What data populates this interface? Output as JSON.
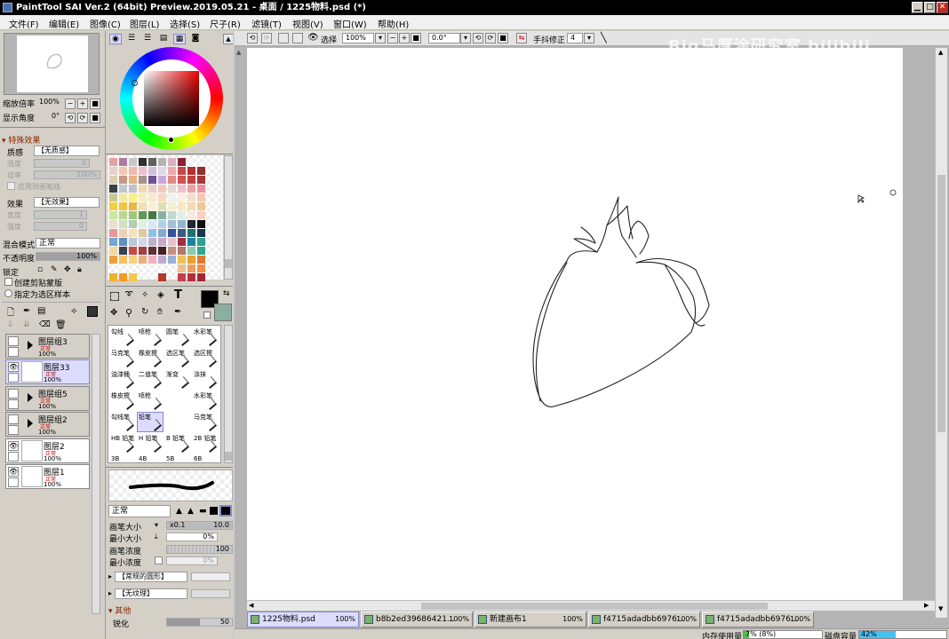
{
  "window": {
    "title": "PaintTool SAI Ver.2 (64bit) Preview.2019.05.21 - 桌面 / 1225物料.psd (*)",
    "controls": [
      "▁",
      "□",
      "✕"
    ]
  },
  "menu": [
    "文件(F)",
    "编辑(E)",
    "图像(C)",
    "图层(L)",
    "选择(S)",
    "尺子(R)",
    "滤镜(T)",
    "视图(V)",
    "窗口(W)",
    "帮助(H)"
  ],
  "navigator": {
    "zoom_label": "缩放倍率",
    "zoom_value": "100%",
    "angle_label": "显示角度",
    "angle_value": "0°"
  },
  "effects": {
    "header": "特殊效果",
    "texture_label": "质感",
    "texture_value": "【无质感】",
    "scale_label": "强度",
    "scale_value": "0",
    "density_label": "倍率",
    "density_value": "100%",
    "sharpen_label": "应用到画笔线",
    "effect_label": "效果",
    "effect_value": "【无效果】",
    "width_label": "宽度",
    "width_value": "1",
    "strength_label": "强度",
    "strength_value": "0"
  },
  "layer_props": {
    "blend_label": "混合模式",
    "blend_value": "正常",
    "opacity_label": "不透明度",
    "opacity_value": "100%",
    "opacity_fraction": 1.0,
    "lock_label": "锁定",
    "clip_label": "创建剪贴蒙版",
    "ref_label": "指定为选区样本"
  },
  "layers": [
    {
      "name": "图层组3",
      "mode": "正常",
      "opacity": "100%",
      "group": true,
      "visible": false,
      "selected": false
    },
    {
      "name": "图层33",
      "mode": "正常",
      "opacity": "100%",
      "group": false,
      "visible": true,
      "selected": true
    },
    {
      "name": "图层组5",
      "mode": "正常",
      "opacity": "100%",
      "group": true,
      "visible": false,
      "selected": false
    },
    {
      "name": "图层组2",
      "mode": "正常",
      "opacity": "100%",
      "group": true,
      "visible": false,
      "selected": false
    },
    {
      "name": "图层2",
      "mode": "正常",
      "opacity": "100%",
      "group": false,
      "visible": true,
      "selected": false
    },
    {
      "name": "图层1",
      "mode": "正常",
      "opacity": "100%",
      "group": false,
      "visible": true,
      "selected": false
    }
  ],
  "tools": [
    {
      "name": "勾线",
      "selected": false
    },
    {
      "name": "喷枪",
      "selected": false
    },
    {
      "name": "圆笔",
      "selected": false
    },
    {
      "name": "水彩笔",
      "selected": false
    },
    {
      "name": "马克笔",
      "selected": false
    },
    {
      "name": "橡皮擦",
      "selected": false
    },
    {
      "name": "选区笔",
      "selected": false
    },
    {
      "name": "选区擦",
      "selected": false
    },
    {
      "name": "油漆桶",
      "selected": false
    },
    {
      "name": "二值笔",
      "selected": false
    },
    {
      "name": "渐变",
      "selected": false
    },
    {
      "name": "涂抹",
      "selected": false
    },
    {
      "name": "橡皮擦",
      "selected": false
    },
    {
      "name": "喷枪",
      "selected": false
    },
    {
      "name": "",
      "selected": false
    },
    {
      "name": "水彩笔",
      "selected": false
    },
    {
      "name": "勾线笔",
      "selected": false
    },
    {
      "name": "铅笔",
      "selected": true
    },
    {
      "name": "",
      "selected": false
    },
    {
      "name": "马克笔",
      "selected": false
    },
    {
      "name": "HB 铅笔",
      "selected": false
    },
    {
      "name": "H 铅笔",
      "selected": false
    },
    {
      "name": "B 铅笔",
      "selected": false
    },
    {
      "name": "2B 铅笔",
      "selected": false
    },
    {
      "name": "3B",
      "selected": false
    },
    {
      "name": "4B",
      "selected": false
    },
    {
      "name": "5B",
      "selected": false
    },
    {
      "name": "6B",
      "selected": false
    }
  ],
  "brush": {
    "blend_value": "正常",
    "size_label": "画笔大小",
    "size_mult": "x0.1",
    "size_value": "10.0",
    "min_size_label": "最小大小",
    "min_size_value": "0%",
    "density_label": "画笔浓度",
    "density_value": "100",
    "min_density_label": "最小浓度",
    "min_density_value": "0%",
    "shape_value": "【常规的圆形】",
    "texture_value": "【无纹理】",
    "other_label": "其他",
    "sharp_label": "锐化",
    "sharp_value": "50"
  },
  "toolbar": {
    "select_label": "选择",
    "zoom_value": "100%",
    "angle_value": "0.0°",
    "stabilizer_label": "手抖修正",
    "stabilizer_value": "4"
  },
  "watermark": "Big马厚涂研究室  bilibili",
  "tabs": [
    {
      "name": "1225物料.psd",
      "zoom": "100%",
      "active": true
    },
    {
      "name": "b8b2ed39686421...",
      "zoom": "100%",
      "active": false
    },
    {
      "name": "新建画布1",
      "zoom": "100%",
      "active": false
    },
    {
      "name": "f4715adadbb6976...",
      "zoom": "100%",
      "active": false
    },
    {
      "name": "f4715adadbb6976...",
      "zoom": "100%",
      "active": false
    }
  ],
  "status": {
    "memory_label": "内存使用量",
    "memory_value": "7% (8%)",
    "disk_label": "磁盘容量",
    "disk_value": "42%",
    "disk_fraction": 0.42
  },
  "colors": {
    "accent_select": "#dcdcff",
    "canvas_bg": "#ffffff",
    "workspace_bg": "#b4b4b4",
    "fg_color": "#000000",
    "bg_color": "#8aafa0"
  }
}
